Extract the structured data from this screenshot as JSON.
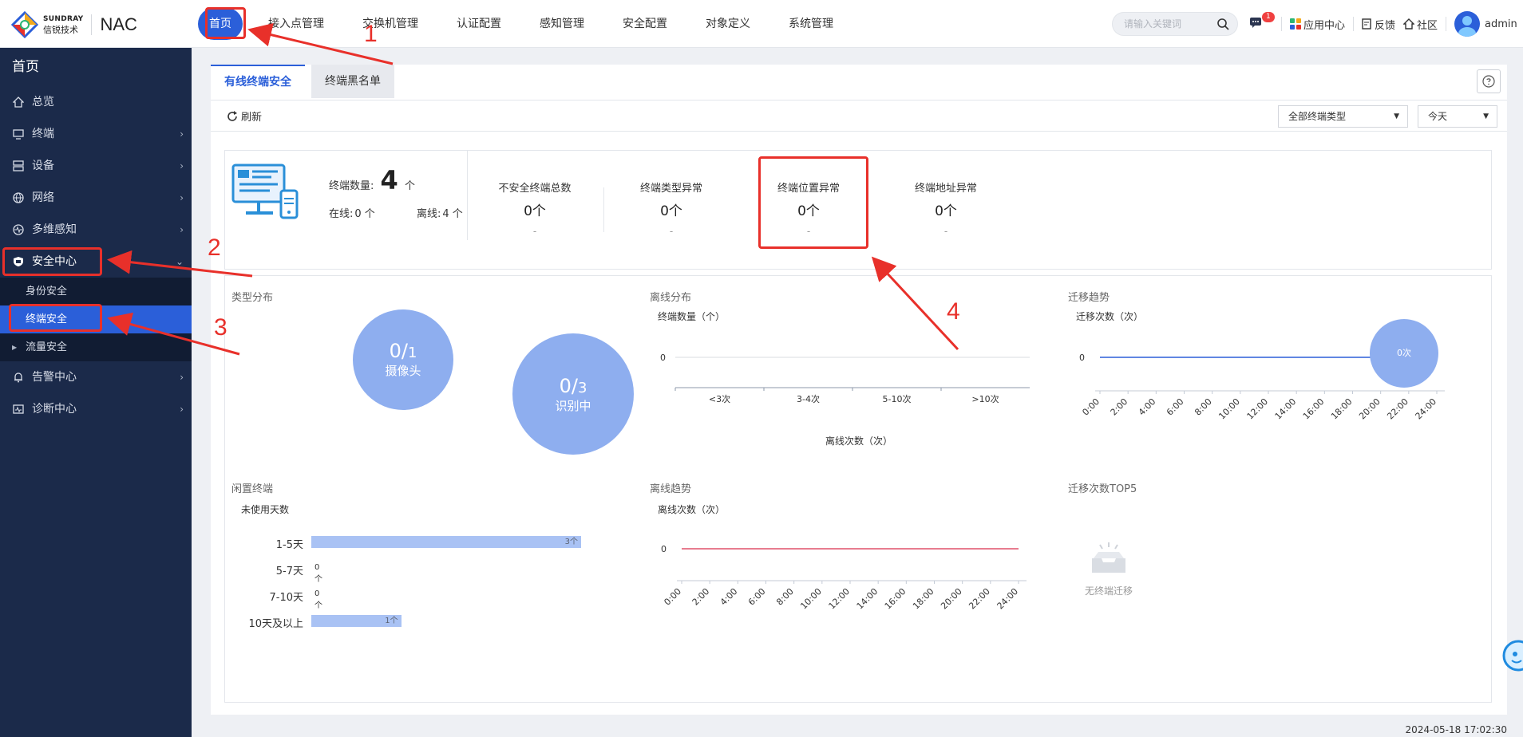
{
  "brand": {
    "en": "SUNDRAY",
    "cn": "信锐技术",
    "product": "NAC"
  },
  "topnav": [
    "首页",
    "接入点管理",
    "交换机管理",
    "认证配置",
    "感知管理",
    "安全配置",
    "对象定义",
    "系统管理"
  ],
  "search": {
    "placeholder": "请输入关键词"
  },
  "header": {
    "msg_count": "1",
    "app_center": "应用中心",
    "feedback": "反馈",
    "community": "社区",
    "user": "admin"
  },
  "sidebar": {
    "title": "首页",
    "items": [
      {
        "label": "总览",
        "icon": "home-icon"
      },
      {
        "label": "终端",
        "icon": "monitor-icon"
      },
      {
        "label": "设备",
        "icon": "server-icon"
      },
      {
        "label": "网络",
        "icon": "globe-icon"
      },
      {
        "label": "多维感知",
        "icon": "pulse-icon"
      },
      {
        "label": "安全中心",
        "icon": "shield-icon"
      }
    ],
    "sub": [
      "身份安全",
      "终端安全",
      "流量安全"
    ],
    "tail": [
      {
        "label": "告警中心",
        "icon": "bell-icon"
      },
      {
        "label": "诊断中心",
        "icon": "diagnose-icon"
      }
    ]
  },
  "tabs": [
    "有线终端安全",
    "终端黑名单"
  ],
  "toolbar": {
    "refresh": "刷新",
    "type_select": "全部终端类型",
    "date_select": "今天"
  },
  "summary": {
    "total_label": "终端数量:",
    "total_value": "4",
    "total_unit": "个",
    "online_label": "在线:",
    "online_value": "0 个",
    "offline_label": "离线:",
    "offline_value": "4 个",
    "metrics": [
      {
        "label": "不安全终端总数",
        "value": "0个",
        "sub": "-"
      },
      {
        "label": "终端类型异常",
        "value": "0个",
        "sub": "-"
      },
      {
        "label": "终端位置异常",
        "value": "0个",
        "sub": "-"
      },
      {
        "label": "终端地址异常",
        "value": "0个",
        "sub": "-"
      }
    ]
  },
  "panels": {
    "type_dist": {
      "title": "类型分布",
      "bubbles": [
        {
          "num": "0/",
          "den": "1",
          "label": "摄像头"
        },
        {
          "num": "0/",
          "den": "3",
          "label": "识别中"
        }
      ]
    },
    "offline_dist": {
      "title": "离线分布",
      "ylabel": "终端数量（个）",
      "xlabel": "离线次数（次）",
      "y_tick": "0"
    },
    "migration_trend": {
      "title": "迁移趋势",
      "ylabel": "迁移次数（次）",
      "y_tick": "0",
      "bubble": "0次"
    },
    "idle": {
      "title": "闲置终端",
      "ylabel": "未使用天数"
    },
    "offline_trend": {
      "title": "离线趋势",
      "ylabel": "离线次数（次）",
      "y_tick": "0"
    },
    "top5": {
      "title": "迁移次数TOP5",
      "empty": "无终端迁移"
    }
  },
  "chart_data": [
    {
      "type": "bar",
      "title": "离线分布",
      "categories": [
        "<3次",
        "3-4次",
        "5-10次",
        ">10次"
      ],
      "values": [
        0,
        0,
        0,
        0
      ],
      "xlabel": "离线次数（次）",
      "ylabel": "终端数量（个）"
    },
    {
      "type": "line",
      "title": "迁移趋势",
      "x": [
        "0:00",
        "2:00",
        "4:00",
        "6:00",
        "8:00",
        "10:00",
        "12:00",
        "14:00",
        "16:00",
        "18:00",
        "20:00",
        "22:00",
        "24:00"
      ],
      "values": [
        0,
        0,
        0,
        0,
        0,
        0,
        0,
        0,
        0,
        0,
        0,
        0,
        0
      ],
      "ylabel": "迁移次数（次）",
      "color": "#2b5fd9"
    },
    {
      "type": "bar",
      "title": "闲置终端",
      "categories": [
        "1-5天",
        "5-7天",
        "7-10天",
        "10天及以上"
      ],
      "values": [
        3,
        0,
        0,
        1
      ],
      "labels": [
        "3个",
        "0个",
        "0个",
        "1个"
      ],
      "ylabel": "未使用天数"
    },
    {
      "type": "line",
      "title": "离线趋势",
      "x": [
        "0:00",
        "2:00",
        "4:00",
        "6:00",
        "8:00",
        "10:00",
        "12:00",
        "14:00",
        "16:00",
        "18:00",
        "20:00",
        "22:00",
        "24:00"
      ],
      "values": [
        0,
        0,
        0,
        0,
        0,
        0,
        0,
        0,
        0,
        0,
        0,
        0,
        0
      ],
      "ylabel": "离线次数（次）",
      "color": "#e0506a"
    }
  ],
  "timestamp": "2024-05-18 17:02:30",
  "annotations": [
    "1",
    "2",
    "3",
    "4"
  ],
  "colors": {
    "accent": "#2b5fd9",
    "sidebar": "#1b2a4a",
    "annotation": "#e8302a"
  }
}
